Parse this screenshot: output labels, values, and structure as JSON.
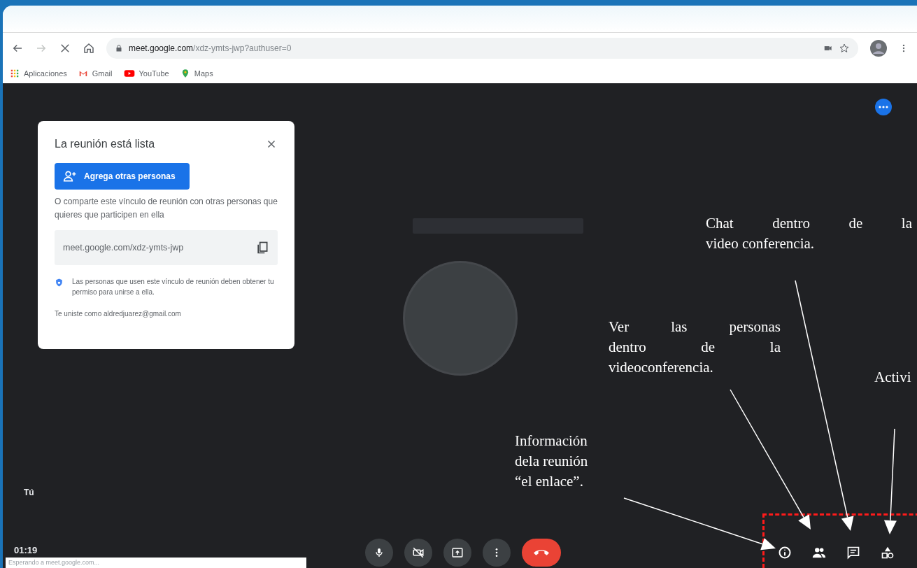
{
  "browser": {
    "url_host": "meet.google.com",
    "url_path": "/xdz-ymts-jwp?authuser=0",
    "bookmarks": [
      {
        "label": "Aplicaciones",
        "kind": "apps"
      },
      {
        "label": "Gmail",
        "kind": "gmail"
      },
      {
        "label": "YouTube",
        "kind": "youtube"
      },
      {
        "label": "Maps",
        "kind": "maps"
      }
    ]
  },
  "meeting_card": {
    "title": "La reunión está lista",
    "add_button": "Agrega otras personas",
    "share_text": "O comparte este vínculo de reunión con otras personas que quieres que participen en ella",
    "link": "meet.google.com/xdz-ymts-jwp",
    "permission_note": "Las personas que usen este vínculo de reunión deben obtener tu permiso para unirse a ella.",
    "joined_as": "Te uniste como aldredjuarez@gmail.com"
  },
  "self_label": "Tú",
  "time": "01:19",
  "status": "Esperando a meet.google.com...",
  "controls": [
    {
      "kind": "mic"
    },
    {
      "kind": "camera_off"
    },
    {
      "kind": "present"
    },
    {
      "kind": "more"
    },
    {
      "kind": "hangup"
    }
  ],
  "side_controls": [
    {
      "kind": "info"
    },
    {
      "kind": "people"
    },
    {
      "kind": "chat"
    },
    {
      "kind": "activities"
    }
  ],
  "annotations": [
    {
      "lines": [
        "Chat dentro de la",
        "video conferencia."
      ]
    },
    {
      "lines": [
        "Ver las personas",
        "dentro de la",
        "videoconferencia."
      ]
    },
    {
      "lines": [
        "Activi"
      ]
    },
    {
      "lines": [
        "Información",
        "dela reunión",
        "“el enlace”."
      ]
    }
  ]
}
